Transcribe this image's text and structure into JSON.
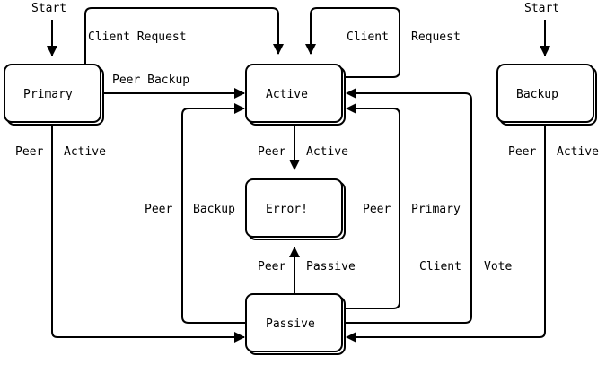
{
  "states": {
    "primary": "Primary",
    "active": "Active",
    "backup": "Backup",
    "error": "Error!",
    "passive": "Passive"
  },
  "start_labels": {
    "left": "Start",
    "right": "Start"
  },
  "transitions": {
    "primary_client_request": "Client Request",
    "active_client": "Client",
    "active_request": "Request",
    "primary_peer_backup": "Peer Backup",
    "primary_peer": "Peer",
    "primary_active": "Active",
    "active_peer": "Peer",
    "active_active": "Active",
    "backup_peer": "Peer",
    "backup_active": "Active",
    "left_peer": "Peer",
    "left_backup": "Backup",
    "right_peer": "Peer",
    "right_primary": "Primary",
    "passive_peer": "Peer",
    "passive_passive": "Passive",
    "client": "Client",
    "vote": "Vote"
  }
}
